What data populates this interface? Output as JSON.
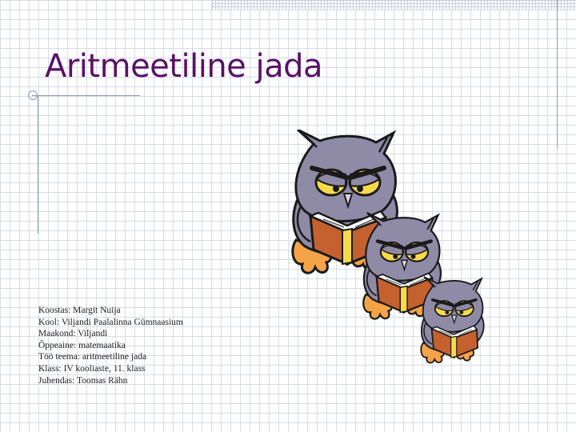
{
  "slide": {
    "title": "Aritmeetiline jada",
    "info_lines": [
      "Koostas: Margit Nuija",
      "Kool: Viljandi Paalalinna Gümnaasium",
      "Maakond: Viljandi",
      "Õppeaine: matemaatika",
      "Töö teema: aritmeetiline jada",
      "Klass: IV kooliaste, 11. klass",
      "Juhendas: Toomas Rähn"
    ]
  },
  "illustration": {
    "subject": "three reading owls",
    "colors": {
      "body": "#8f8aa6",
      "belly": "#c9c6d8",
      "book": "#c4612f",
      "feet": "#f4a347",
      "eyes": "#f7d94c",
      "title": "#5a1166"
    }
  }
}
